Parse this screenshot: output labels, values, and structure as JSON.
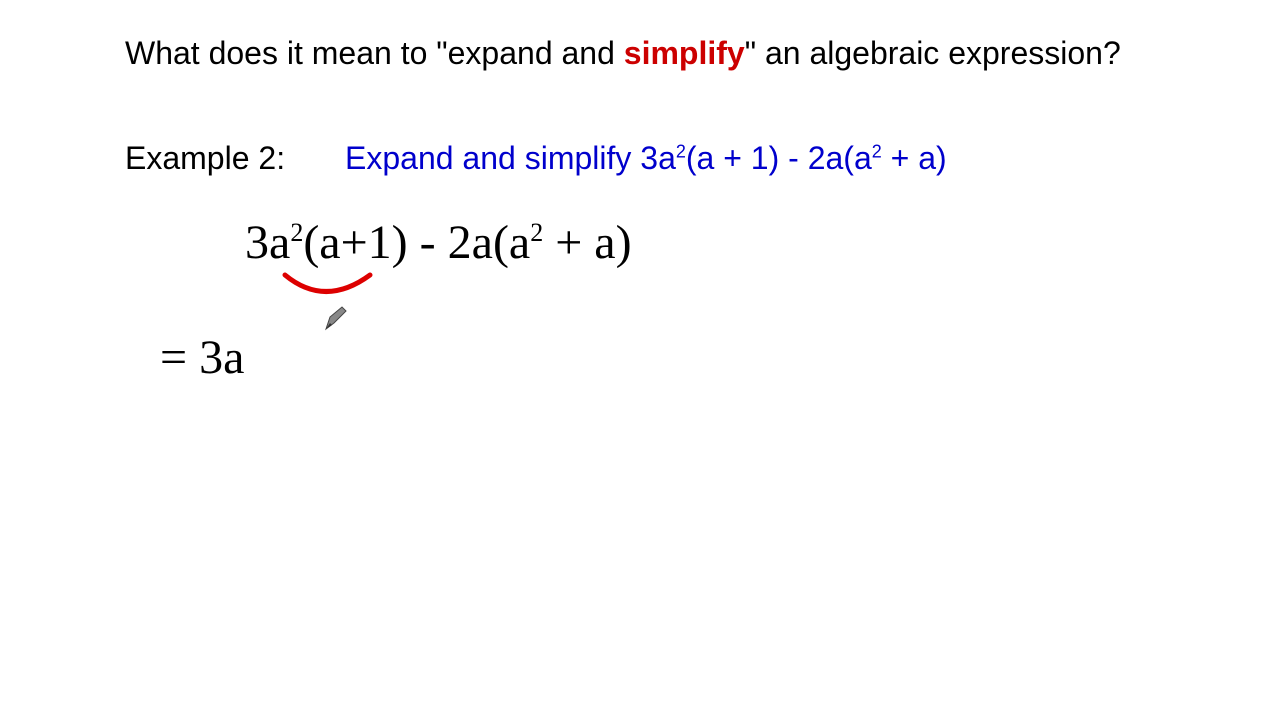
{
  "title": {
    "prefix": "What does it mean to \"expand and ",
    "highlight": "simplify",
    "suffix": "\" an algebraic expression?"
  },
  "example": {
    "label": "Example 2:",
    "text_prefix": "Expand and simplify 3a",
    "sup1": "2",
    "text_mid1": "(a + 1) - 2a(a",
    "sup2": "2",
    "text_suffix": " + a)"
  },
  "handwritten": {
    "expr_part1": "3a",
    "expr_sup1": "2",
    "expr_part2": "(a+1) - 2a(a",
    "expr_sup2": "2",
    "expr_part3": " + a)",
    "result": "=   3a"
  },
  "colors": {
    "highlight": "#cc0000",
    "problem": "#0000cc",
    "arc": "#dd0000"
  }
}
